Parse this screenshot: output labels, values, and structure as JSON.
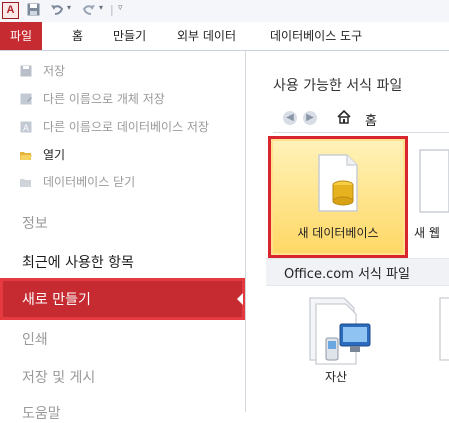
{
  "quick_access": {
    "app_letter": "A",
    "icons": [
      "save-icon",
      "undo-icon",
      "redo-icon",
      "customize-icon"
    ]
  },
  "ribbon_tabs": [
    {
      "label": "파일",
      "active": true
    },
    {
      "label": "홈"
    },
    {
      "label": "만들기"
    },
    {
      "label": "외부 데이터"
    },
    {
      "label": "데이터베이스 도구"
    }
  ],
  "backstage": {
    "commands": [
      {
        "label": "저장",
        "enabled": false
      },
      {
        "label": "다른 이름으로 개체 저장",
        "enabled": false
      },
      {
        "label": "다른 이름으로 데이터베이스 저장",
        "enabled": false
      },
      {
        "label": "열기",
        "enabled": true
      },
      {
        "label": "데이터베이스 닫기",
        "enabled": false
      }
    ],
    "sections": [
      {
        "label": "정보",
        "enabled": false
      },
      {
        "label": "최근에 사용한 항목",
        "enabled": true
      },
      {
        "label": "새로 만들기",
        "active": true
      },
      {
        "label": "인쇄",
        "enabled": false
      },
      {
        "label": "저장 및 게시",
        "enabled": false
      },
      {
        "label": "도움말",
        "enabled": false
      }
    ]
  },
  "templates": {
    "heading": "사용 가능한 서식 파일",
    "breadcrumb": "홈",
    "tiles": [
      {
        "label": "새 데이터베이스",
        "selected": true
      },
      {
        "label": "새 웹"
      }
    ],
    "online_group": "Office.com 서식 파일",
    "online_tiles": [
      {
        "label": "자산"
      }
    ]
  },
  "colors": {
    "accent": "#c62b32",
    "selection_border": "#d9262e",
    "tile_fill": "#ffe08c"
  }
}
